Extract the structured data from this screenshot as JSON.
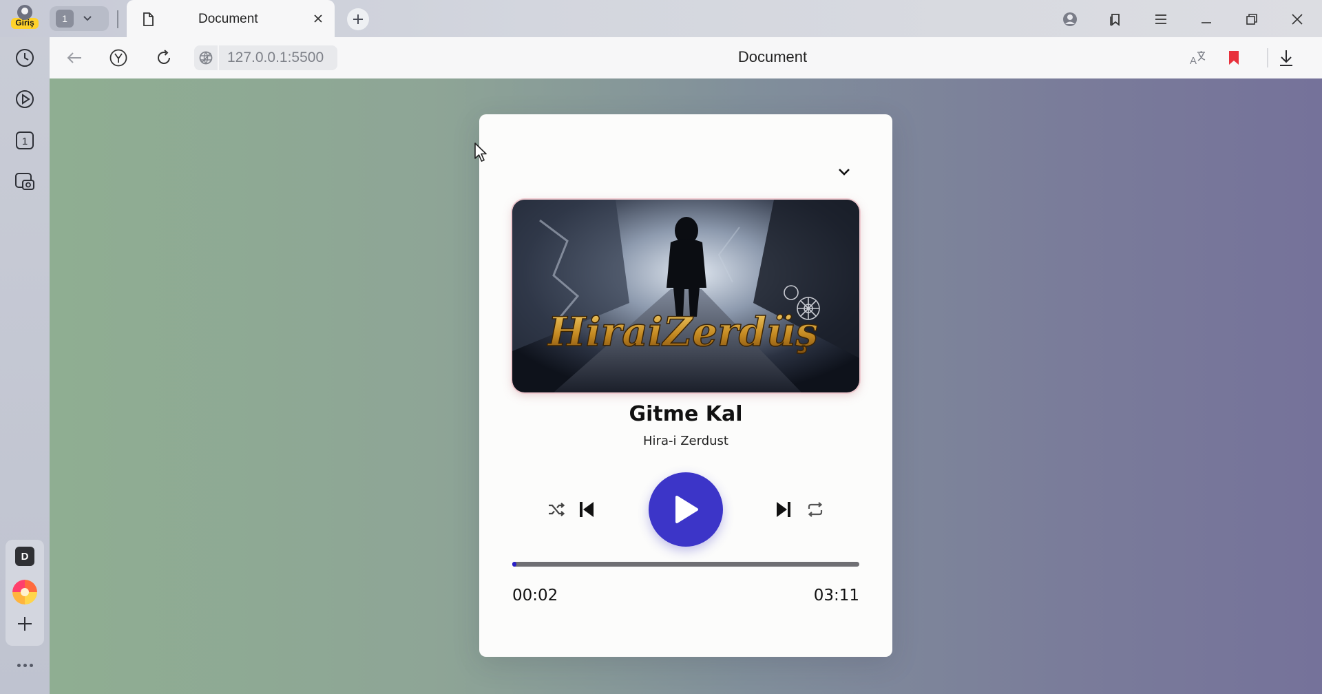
{
  "browser": {
    "profile_label": "Giriş",
    "tab_group_count": "1",
    "tab": {
      "title": "Document"
    },
    "address": {
      "url": "127.0.0.1:5500",
      "page_title": "Document"
    },
    "sidebar": {
      "workspace_letter": "D",
      "tab_counter": "1"
    },
    "accent_color": "#e8313c"
  },
  "player": {
    "song_title": "Gitme Kal",
    "artist": "Hira-i Zerdust",
    "album_art_text": "HiraiZerdüş",
    "current_time": "00:02",
    "duration": "03:11",
    "progress_fraction": 0.011,
    "play_button_color": "#3c35c8",
    "progress_color": "#2a20c8"
  }
}
